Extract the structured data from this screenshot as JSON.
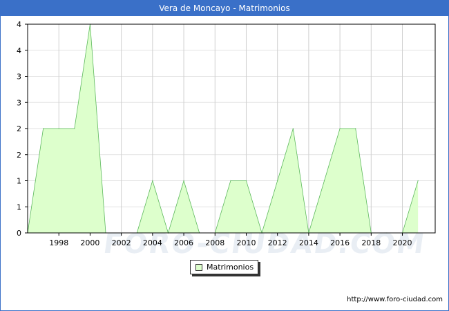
{
  "window": {
    "title": "Vera de Moncayo - Matrimonios",
    "title_bg": "#3a70c8"
  },
  "footer": {
    "source_url": "http://www.foro-ciudad.com"
  },
  "watermark_text": "FORO-CIUDAD.COM",
  "chart_data": {
    "type": "area",
    "title": "Vera de Moncayo - Matrimonios",
    "xlabel": "",
    "ylabel": "",
    "x": [
      1996,
      1997,
      1998,
      1999,
      2000,
      2001,
      2002,
      2003,
      2004,
      2005,
      2006,
      2007,
      2008,
      2009,
      2010,
      2011,
      2012,
      2013,
      2014,
      2015,
      2016,
      2017,
      2018,
      2019,
      2020,
      2021
    ],
    "series": [
      {
        "name": "Matrimonios",
        "values": [
          0,
          2,
          2,
          2,
          4,
          0,
          0,
          0,
          1,
          0,
          1,
          0,
          0,
          1,
          1,
          0,
          1,
          2,
          0,
          1,
          2,
          2,
          0,
          0,
          0,
          1
        ],
        "fill_color": "#ddffcc",
        "line_color": "#5cb85c"
      }
    ],
    "x_tick_labels": [
      "1998",
      "2000",
      "2002",
      "2004",
      "2006",
      "2008",
      "2010",
      "2012",
      "2014",
      "2016",
      "2018",
      "2020"
    ],
    "y_tick_labels": [
      "0",
      "1",
      "1",
      "2",
      "2",
      "3",
      "3",
      "4",
      "4"
    ],
    "xlim": [
      1996,
      2022.1
    ],
    "ylim": [
      0,
      4
    ],
    "grid": true,
    "legend_position": "bottom-center"
  }
}
